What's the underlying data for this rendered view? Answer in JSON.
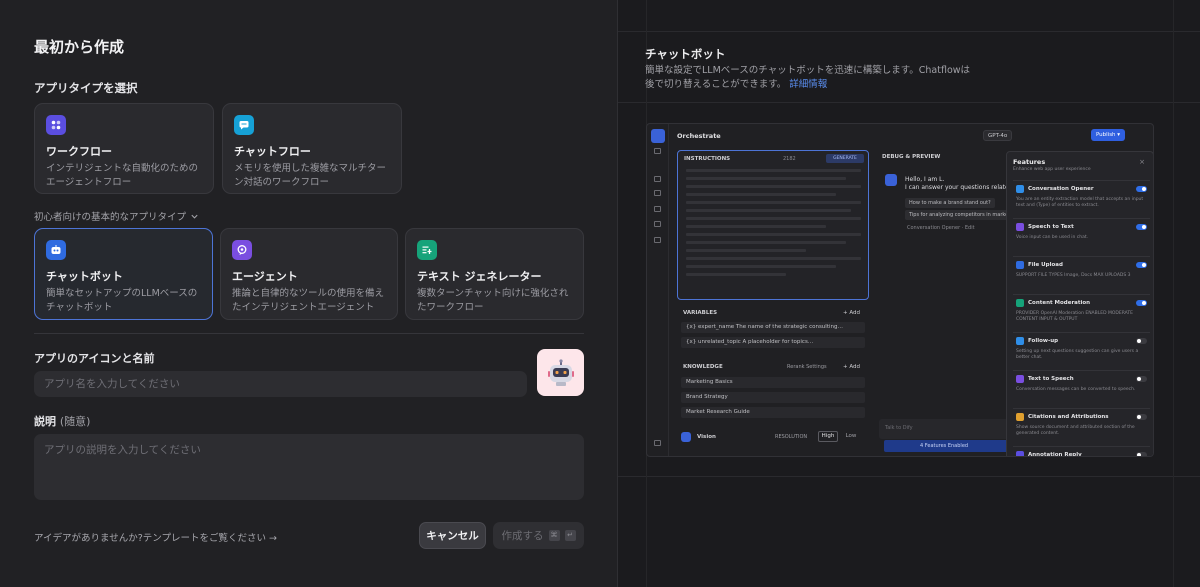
{
  "left": {
    "title": "最初から作成",
    "app_type_label": "アプリタイプを選択",
    "top_cards": [
      {
        "title": "ワークフロー",
        "desc": "インテリジェントな自動化のためのエージェントフロー",
        "icon": "workflow-icon",
        "color": "#5b4ee0"
      },
      {
        "title": "チャットフロー",
        "desc": "メモリを使用した複雑なマルチターン対話のワークフロー",
        "icon": "chatflow-icon",
        "color": "#16a1d6"
      }
    ],
    "beginner_label": "初心者向けの基本的なアプリタイプ",
    "basic_cards": [
      {
        "title": "チャットボット",
        "desc": "簡単なセットアップのLLMベースのチャットボット",
        "icon": "chatbot-icon",
        "color": "#2f6be0"
      },
      {
        "title": "エージェント",
        "desc": "推論と自律的なツールの使用を備えたインテリジェントエージェント",
        "icon": "agent-icon",
        "color": "#7a4ee0"
      },
      {
        "title": "テキスト ジェネレーター",
        "desc": "複数ターンチャット向けに強化されたワークフロー",
        "icon": "text-generator-icon",
        "color": "#16a37a"
      }
    ],
    "icon_name_label": "アプリのアイコンと名前",
    "name_placeholder": "アプリ名を入力してください",
    "desc_label": "説明",
    "desc_optional": "(随意)",
    "desc_placeholder": "アプリの説明を入力してください",
    "idea_link": "アイデアがありませんか?テンプレートをご覧ください →",
    "cancel_label": "キャンセル",
    "create_label": "作成する",
    "create_kbd": [
      "⌘",
      "↵"
    ]
  },
  "right": {
    "title": "チャットボット",
    "desc": "簡単な設定でLLMベースのチャットボットを迅速に構築します。Chatflowは後で切り替えることができます。",
    "learn_more": "詳細情報"
  },
  "preview": {
    "orchestrate": "Orchestrate",
    "model": "GPT-4o",
    "publish": "Publish ▾",
    "instructions": "INSTRUCTIONS",
    "instr_count": "2182",
    "generate": "GENERATE",
    "variables": "VARIABLES",
    "add": "+ Add",
    "var_rows": [
      "{x} expert_name  The name of the strategic consulting…",
      "{x} unrelated_topic  A placeholder for topics…"
    ],
    "knowledge": "KNOWLEDGE",
    "rerank": "Rerank Settings",
    "kn_rows": [
      "Marketing Basics",
      "Brand Strategy",
      "Market Research Guide"
    ],
    "vision": "Vision",
    "resolution": "RESOLUTION",
    "high": "High",
    "low": "Low",
    "debug": "DEBUG & PREVIEW",
    "hello1": "Hello, I am L.",
    "hello2": "I can answer your questions related",
    "suggestions": [
      "How to make a brand stand out?",
      "Tips for analyzing competitors in market"
    ],
    "opener": "Conversation Opener · Edit",
    "talk": "Talk to Dify",
    "features_enabled": "4 Features Enabled",
    "features_title": "Features",
    "features_sub": "Enhance web app user experience",
    "features": [
      {
        "name": "Conversation Opener",
        "desc": "You are an entity extraction model that accepts an input text and (Type) of entities to extract.",
        "on": true,
        "color": "#2f8ee8"
      },
      {
        "name": "Speech to Text",
        "desc": "Voice input can be used in chat.",
        "on": true,
        "color": "#7a4ee0"
      },
      {
        "name": "File Upload",
        "desc": "SUPPORT FILE TYPES  Image, Docs   MAX UPLOADS 3",
        "on": true,
        "color": "#2f6be0"
      },
      {
        "name": "Content Moderation",
        "desc": "PROVIDER OpenAI Moderation   ENABLED MODERATE CONTENT INPUT & OUTPUT",
        "on": true,
        "color": "#16a37a"
      },
      {
        "name": "Follow-up",
        "desc": "Setting up next questions suggestion can give users a better chat.",
        "on": false,
        "color": "#2f8ee8"
      },
      {
        "name": "Text to Speech",
        "desc": "Conversation messages can be converted to speech.",
        "on": false,
        "color": "#7a4ee0"
      },
      {
        "name": "Citations and Attributions",
        "desc": "Show source document and attributed section of the generated content.",
        "on": false,
        "color": "#e0a02f"
      },
      {
        "name": "Annotation Reply",
        "desc": "",
        "on": false,
        "color": "#5b4ee0"
      }
    ]
  }
}
